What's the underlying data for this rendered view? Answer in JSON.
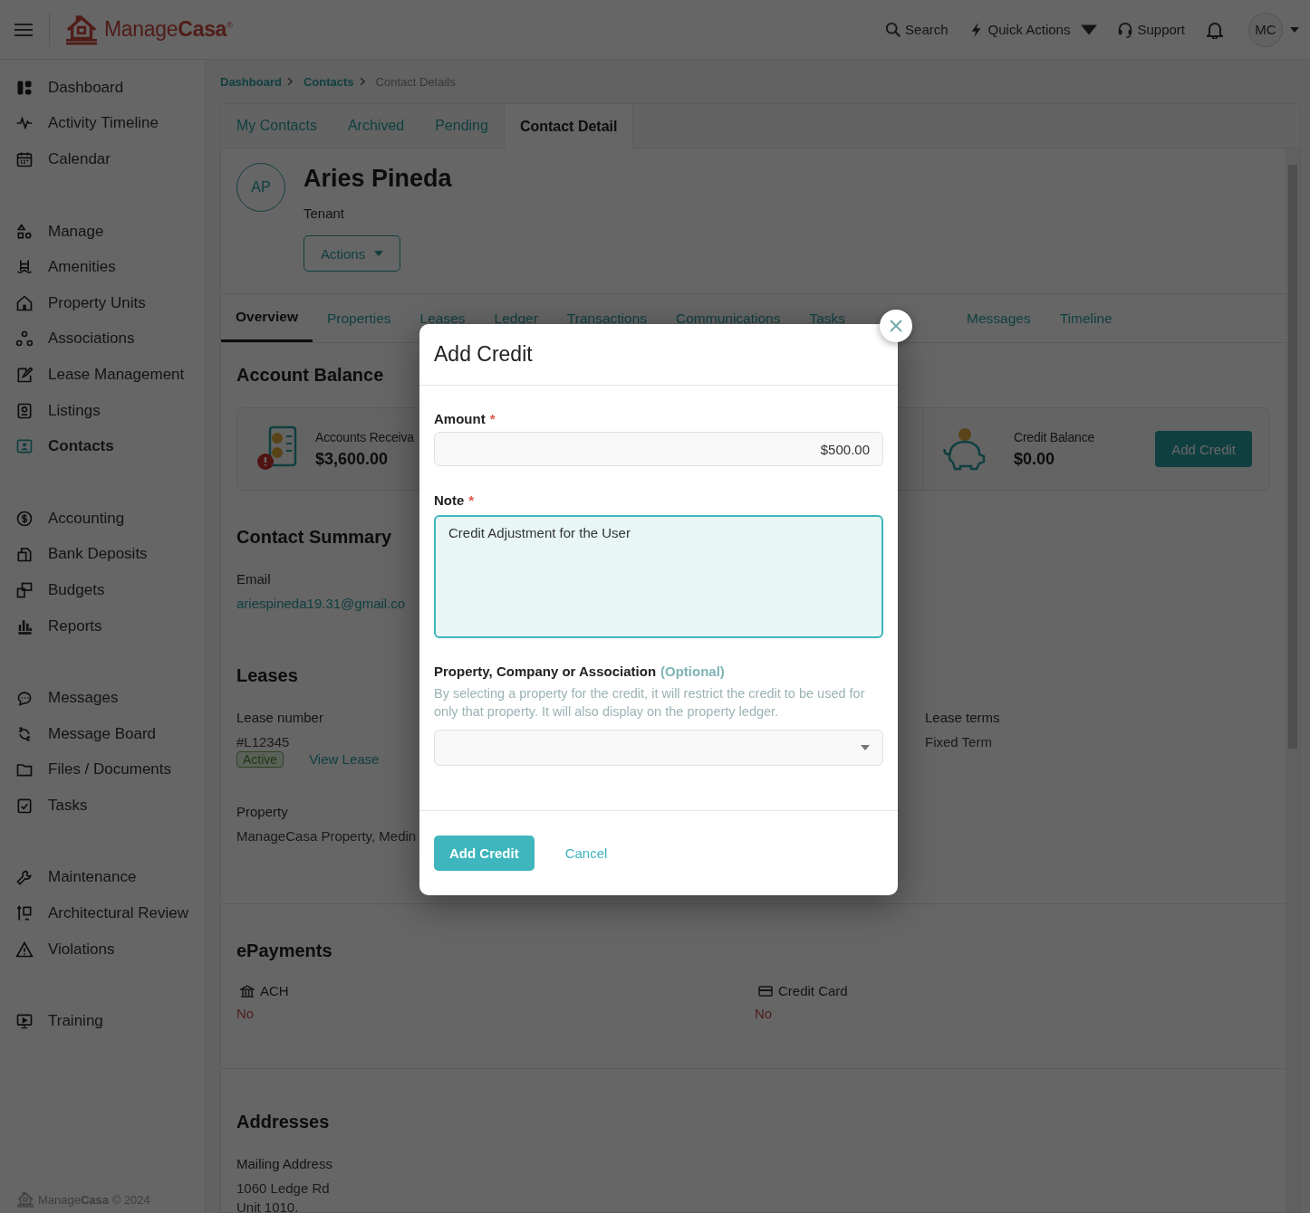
{
  "header": {
    "logo": {
      "light": "Manage",
      "bold": "Casa",
      "mark": "®"
    },
    "actions": [
      {
        "kind": "search",
        "label": "Search"
      },
      {
        "kind": "quick",
        "label": "Quick Actions"
      },
      {
        "kind": "support",
        "label": "Support"
      }
    ],
    "avatar": "MC"
  },
  "sidebar": {
    "groups": [
      [
        {
          "label": "Dashboard",
          "selected": false
        },
        {
          "label": "Activity Timeline",
          "selected": false
        },
        {
          "label": "Calendar",
          "selected": false
        }
      ],
      [
        {
          "label": "Manage",
          "selected": false
        },
        {
          "label": "Amenities",
          "selected": false
        },
        {
          "label": "Property Units",
          "selected": false
        },
        {
          "label": "Associations",
          "selected": false
        },
        {
          "label": "Lease Management",
          "selected": false
        },
        {
          "label": "Listings",
          "selected": false
        },
        {
          "label": "Contacts",
          "selected": true
        }
      ],
      [
        {
          "label": "Accounting",
          "selected": false
        },
        {
          "label": "Bank Deposits",
          "selected": false
        },
        {
          "label": "Budgets",
          "selected": false
        },
        {
          "label": "Reports",
          "selected": false
        }
      ],
      [
        {
          "label": "Messages",
          "selected": false
        },
        {
          "label": "Message Board",
          "selected": false
        },
        {
          "label": "Files / Documents",
          "selected": false
        },
        {
          "label": "Tasks",
          "selected": false
        }
      ],
      [
        {
          "label": "Maintenance",
          "selected": false
        },
        {
          "label": "Architectural Review",
          "selected": false
        },
        {
          "label": "Violations",
          "selected": false
        }
      ],
      [
        {
          "label": "Training",
          "selected": false
        }
      ]
    ],
    "footer": {
      "light": "Manage",
      "bold": "Casa",
      "copyright": "© 2024"
    }
  },
  "breadcrumb": [
    "Dashboard",
    "Contacts",
    "Contact Details"
  ],
  "top_tabs": [
    {
      "label": "My Contacts",
      "selected": false
    },
    {
      "label": "Archived",
      "selected": false
    },
    {
      "label": "Pending",
      "selected": false
    },
    {
      "label": "Contact Detail",
      "selected": true
    }
  ],
  "contact": {
    "initials": "AP",
    "name": "Aries Pineda",
    "role": "Tenant",
    "actions_button": "Actions"
  },
  "detail_tabs": [
    {
      "label": "Overview",
      "selected": true
    },
    {
      "label": "Properties",
      "selected": false
    },
    {
      "label": "Leases",
      "selected": false
    },
    {
      "label": "Ledger",
      "selected": false
    },
    {
      "label": "Transactions",
      "selected": false
    },
    {
      "label": "Communications",
      "selected": false
    },
    {
      "label": "Tasks",
      "selected": false
    },
    {
      "label": "Messages",
      "selected": false
    },
    {
      "label": "Timeline",
      "selected": false
    }
  ],
  "account_balance": {
    "title": "Account Balance",
    "receivable": {
      "label": "Accounts Receiva",
      "amount": "$3,600.00"
    },
    "credit": {
      "label": "Credit Balance",
      "amount": "$0.00",
      "button": "Add Credit"
    }
  },
  "contact_summary": {
    "title": "Contact Summary",
    "email_label": "Email",
    "email": "ariespineda19.31@gmail.co"
  },
  "leases": {
    "title": "Leases",
    "number_label": "Lease number",
    "number": "#L12345",
    "status": "Active",
    "view_link": "View Lease",
    "terms_label": "Lease terms",
    "terms": "Fixed Term",
    "property_label": "Property",
    "property": "ManageCasa Property, Medin"
  },
  "epayments": {
    "title": "ePayments",
    "methods": [
      {
        "kind": "bank",
        "label": "ACH",
        "value": "No"
      },
      {
        "kind": "card",
        "label": "Credit Card",
        "value": "No"
      }
    ]
  },
  "addresses": {
    "title": "Addresses",
    "label": "Mailing Address",
    "lines": [
      "1060 Ledge Rd",
      "Unit 1010."
    ]
  },
  "modal": {
    "title": "Add Credit",
    "amount": {
      "label": "Amount",
      "required_mark": "*",
      "value": "$500.00"
    },
    "note": {
      "label": "Note",
      "required_mark": "*",
      "value": "Credit Adjustment for the User"
    },
    "property": {
      "label": "Property, Company or Association",
      "optional": "(Optional)",
      "help": "By selecting a property for the credit, it will restrict the credit to be used for only that property. It will also display on the property ledger."
    },
    "submit": "Add Credit",
    "cancel": "Cancel"
  }
}
